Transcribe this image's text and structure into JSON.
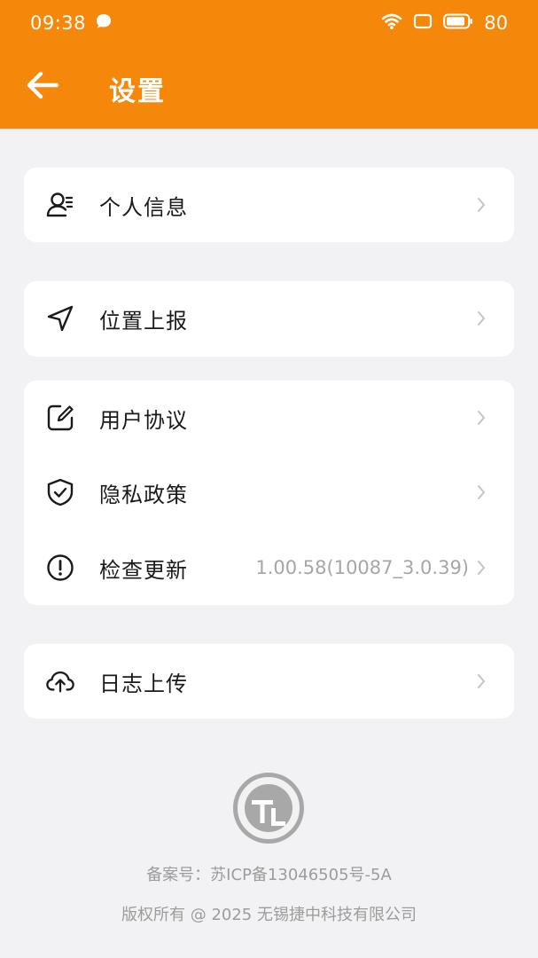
{
  "status_bar": {
    "time": "09:38",
    "battery": "80",
    "icons": [
      "chat-bubble-icon",
      "wifi-icon",
      "screen-icon",
      "battery-icon"
    ]
  },
  "header": {
    "title": "设置",
    "back_icon": "arrow-left-icon"
  },
  "menu": {
    "personal_info": {
      "label": "个人信息",
      "icon": "user-list-icon"
    },
    "location_report": {
      "label": "位置上报",
      "icon": "navigation-icon"
    },
    "user_agreement": {
      "label": "用户协议",
      "icon": "edit-icon"
    },
    "privacy_policy": {
      "label": "隐私政策",
      "icon": "shield-check-icon"
    },
    "check_update": {
      "label": "检查更新",
      "icon": "alert-circle-icon",
      "value": "1.00.58(10087_3.0.39)"
    },
    "log_upload": {
      "label": "日志上传",
      "icon": "cloud-upload-icon"
    }
  },
  "footer": {
    "icp": "备案号：苏ICP备13046505号-5A",
    "copyright": "版权所有 @ 2025 无锡捷中科技有限公司"
  },
  "colors": {
    "accent": "#f5870a",
    "background": "#f2f2f4",
    "card": "#ffffff",
    "muted_text": "#a6a6a6"
  }
}
